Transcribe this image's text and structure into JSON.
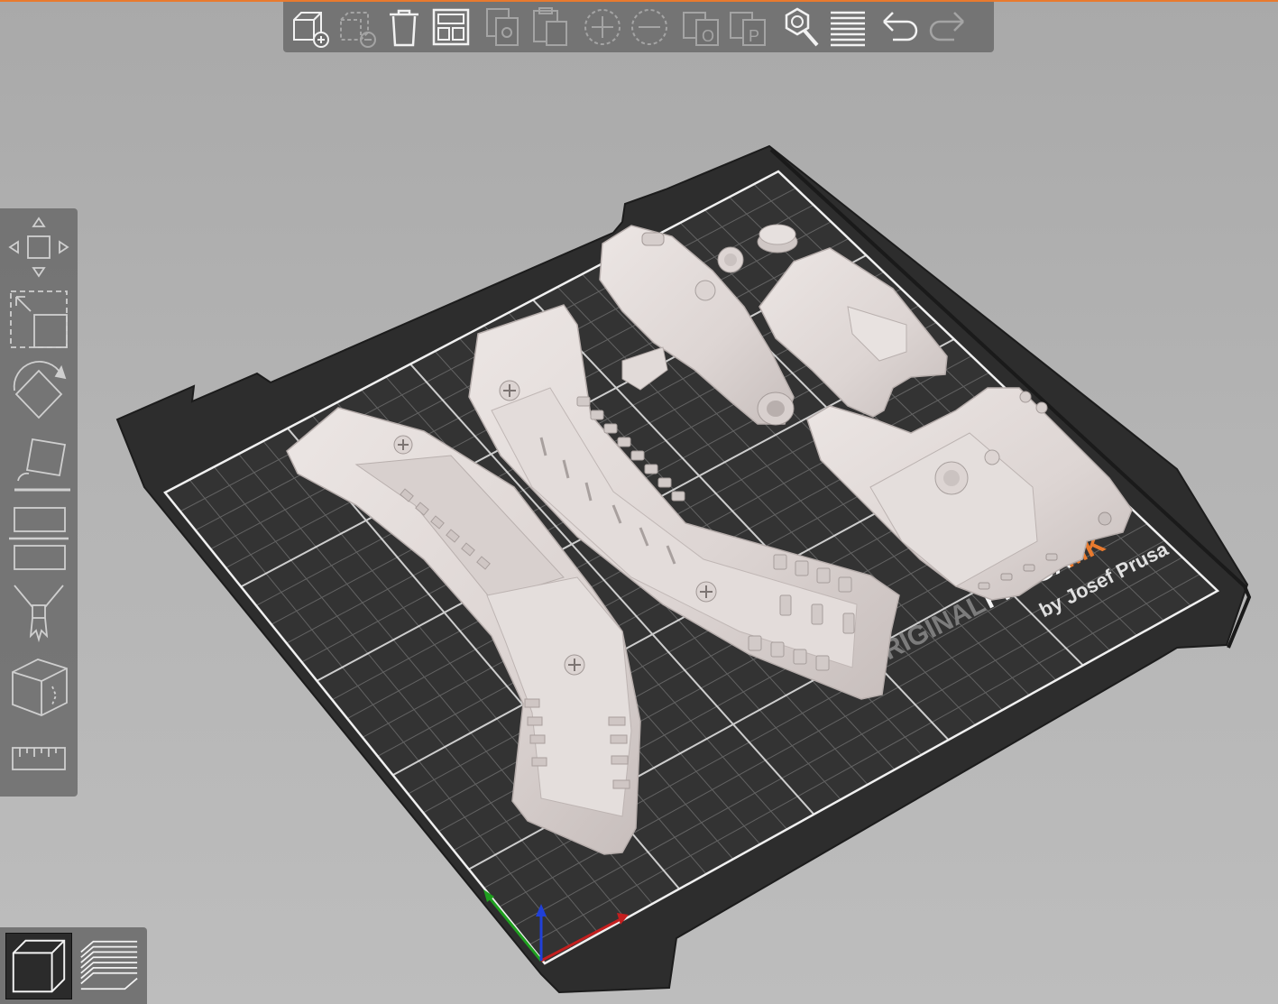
{
  "app": {
    "accent_color": "#e97a2e"
  },
  "top_toolbar": {
    "buttons": [
      {
        "name": "add-object",
        "icon": "cube-plus-icon",
        "enabled": true
      },
      {
        "name": "delete-object",
        "icon": "cube-minus-icon",
        "enabled": false
      },
      {
        "name": "delete-all",
        "icon": "trash-icon",
        "enabled": true
      },
      {
        "name": "arrange",
        "icon": "arrange-icon",
        "enabled": true
      },
      {
        "name": "copy",
        "icon": "copy-icon",
        "enabled": false
      },
      {
        "name": "paste",
        "icon": "paste-icon",
        "enabled": false
      },
      {
        "name": "add-instance",
        "icon": "plus-circle-icon",
        "enabled": false
      },
      {
        "name": "remove-instance",
        "icon": "minus-circle-icon",
        "enabled": false
      },
      {
        "name": "split-objects",
        "icon": "split-objects-icon",
        "enabled": false
      },
      {
        "name": "split-parts",
        "icon": "split-parts-icon",
        "enabled": false
      },
      {
        "name": "search",
        "icon": "search-icon",
        "enabled": true
      },
      {
        "name": "layers-editing",
        "icon": "layers-icon",
        "enabled": true
      },
      {
        "name": "undo",
        "icon": "undo-icon",
        "enabled": true
      },
      {
        "name": "redo",
        "icon": "redo-icon",
        "enabled": false
      }
    ]
  },
  "left_toolbar": {
    "tools": [
      "move-icon",
      "scale-icon",
      "rotate-icon",
      "place-on-face-icon",
      "cut-icon",
      "paint-supports-icon",
      "seam-painting-icon",
      "measure-icon"
    ]
  },
  "bed": {
    "logo_line1_a": "RIGINAL",
    "logo_line1_b": "PRUSA",
    "logo_line1_c": "MK",
    "logo_line2": "by Josef Prusa"
  },
  "view_switch": {
    "active": "3d-view"
  }
}
